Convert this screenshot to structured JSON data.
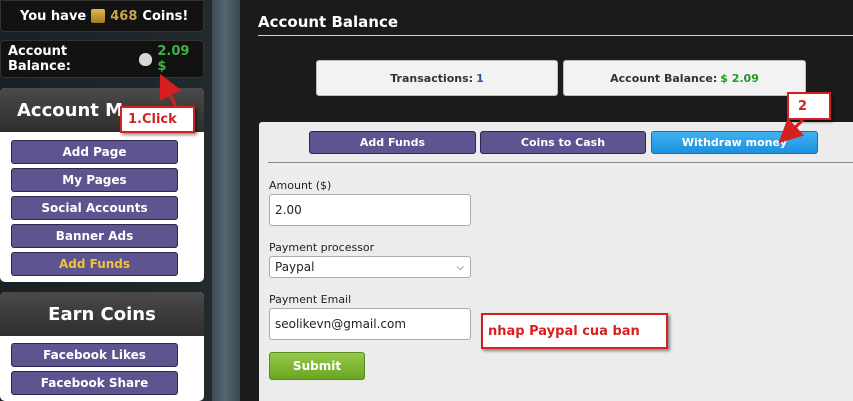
{
  "sidebar": {
    "coins": {
      "prefix": "You have",
      "value": "468",
      "suffix": "Coins!"
    },
    "balance": {
      "label": "Account Balance:",
      "value": "2.09 $"
    },
    "account_panel": {
      "title": "Account Ma",
      "items": [
        {
          "label": "Add Page"
        },
        {
          "label": "My Pages"
        },
        {
          "label": "Social Accounts"
        },
        {
          "label": "Banner Ads"
        },
        {
          "label": "Add Funds",
          "active": true
        }
      ]
    },
    "earn_panel": {
      "title": "Earn Coins",
      "items": [
        {
          "label": "Facebook Likes"
        },
        {
          "label": "Facebook Share"
        }
      ]
    }
  },
  "main": {
    "title": "Account Balance",
    "stats": {
      "transactions_label": "Transactions:",
      "transactions_value": "1",
      "balance_label": "Account Balance:",
      "balance_value": "$ 2.09"
    },
    "tabs": [
      {
        "label": "Add Funds"
      },
      {
        "label": "Coins to Cash"
      },
      {
        "label": "Withdraw money",
        "active": true
      }
    ],
    "form": {
      "amount_label": "Amount ($)",
      "amount_value": "2.00",
      "processor_label": "Payment processor",
      "processor_value": "Paypal",
      "email_label": "Payment Email",
      "email_value": "seolikevn@gmail.com",
      "submit_label": "Submit"
    }
  },
  "annotations": {
    "step1": "1.Click",
    "step2": "2",
    "note": "nhap Paypal cua ban"
  },
  "colors": {
    "button": "#5d5490",
    "active_tab": "#1d8fdf",
    "balance_green": "#3db63d",
    "annotation_red": "#d81f1f",
    "submit_green": "#6aa621"
  }
}
